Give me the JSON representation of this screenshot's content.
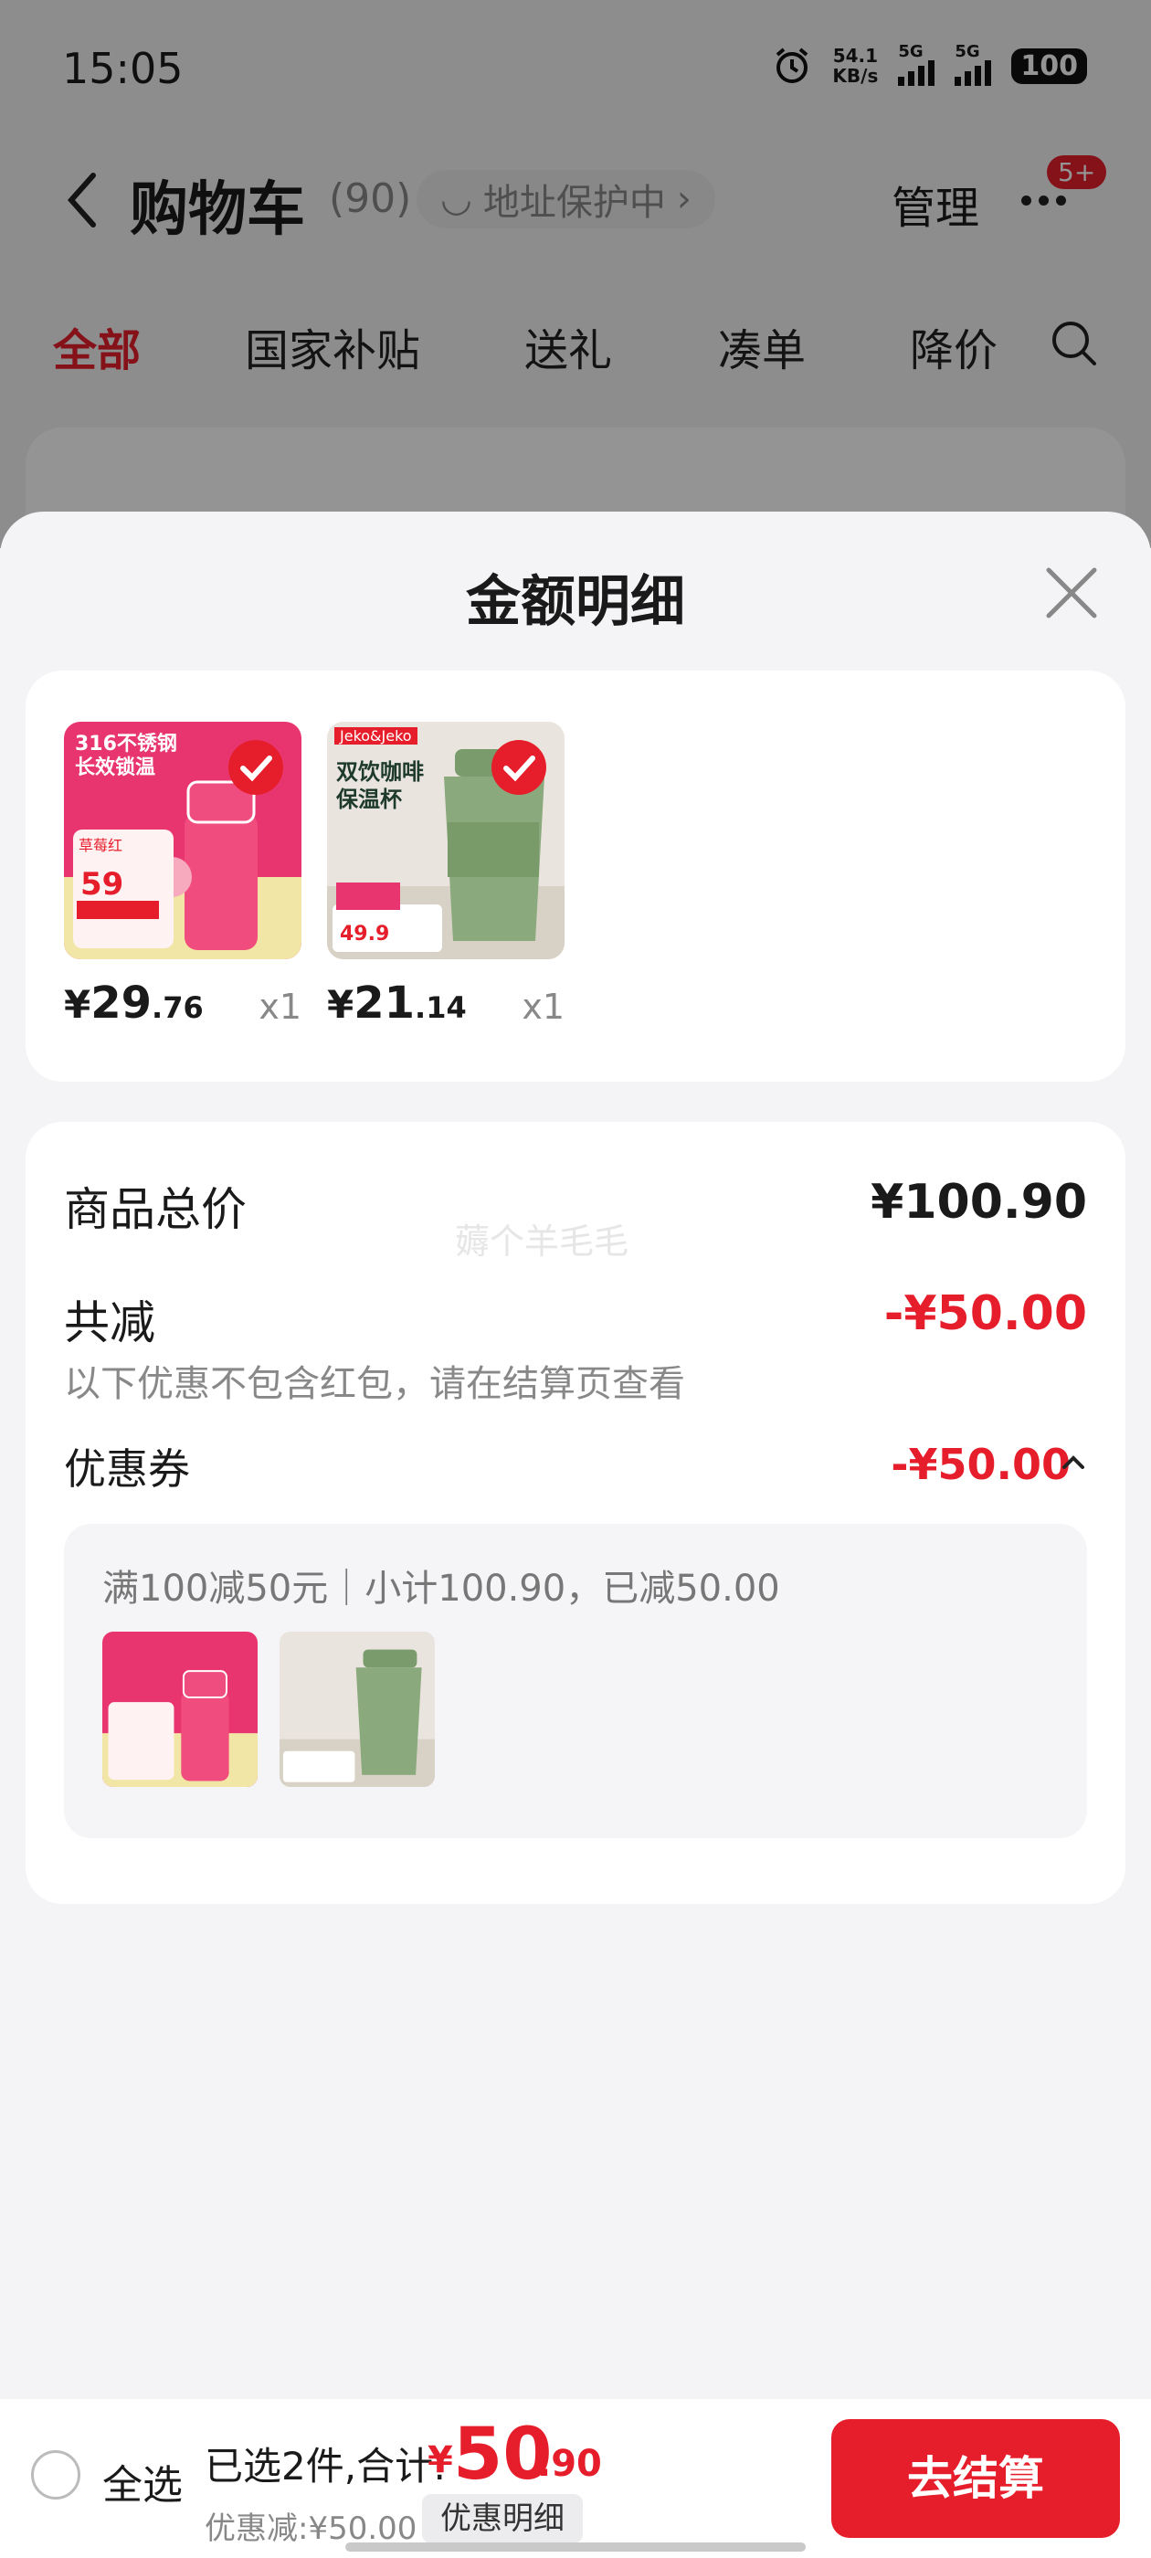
{
  "status_bar": {
    "time": "15:05",
    "net_speed_value": "54.1",
    "net_speed_unit": "KB/s",
    "sim1": "5G",
    "sim2": "5G",
    "battery": "100"
  },
  "header": {
    "title": "购物车",
    "count": "(90)",
    "address_pill": "地址保护中",
    "manage": "管理",
    "badge": "5+"
  },
  "tabs": [
    {
      "label": "全部",
      "active": true
    },
    {
      "label": "国家补贴"
    },
    {
      "label": "送礼"
    },
    {
      "label": "凑单"
    },
    {
      "label": "降价"
    }
  ],
  "sheet": {
    "title": "金额明细",
    "products": [
      {
        "name": "pink-bottle",
        "yen": "¥",
        "price_int": "29",
        "price_dec": ".76",
        "qty": "x1",
        "thumb_texts": [
          "316不锈钢",
          "长效锁温",
          "草莓红",
          "59"
        ]
      },
      {
        "name": "green-cup",
        "yen": "¥",
        "price_int": "21",
        "price_dec": ".14",
        "qty": "x1",
        "thumb_texts": [
          "Jeko&Jeko",
          "双饮咖啡",
          "保温杯",
          "49.9"
        ]
      }
    ],
    "summary": {
      "total_label": "商品总价",
      "total_value": "¥100.90",
      "reduce_label": "共减",
      "reduce_value": "-¥50.00",
      "note": "以下优惠不包含红包，请在结算页查看",
      "coupon_label": "优惠券",
      "coupon_value": "-¥50.00",
      "coupon_desc": "满100减50元｜小计100.90，已减50.00",
      "watermark": "薅个羊毛毛"
    }
  },
  "bottom_bar": {
    "select_all": "全选",
    "selected_text": "已选2件,合计:",
    "total_yen": "¥",
    "total_int": "50",
    "total_dec": ".90",
    "discount_text": "优惠减:¥50.00",
    "detail_button": "优惠明细",
    "checkout_button": "去结算"
  },
  "colors": {
    "accent": "#e61e2b",
    "sheet_bg": "#f4f4f6",
    "card_bg": "#ffffff",
    "pink_product": "#e8356f",
    "green_product": "#8aa97c"
  }
}
